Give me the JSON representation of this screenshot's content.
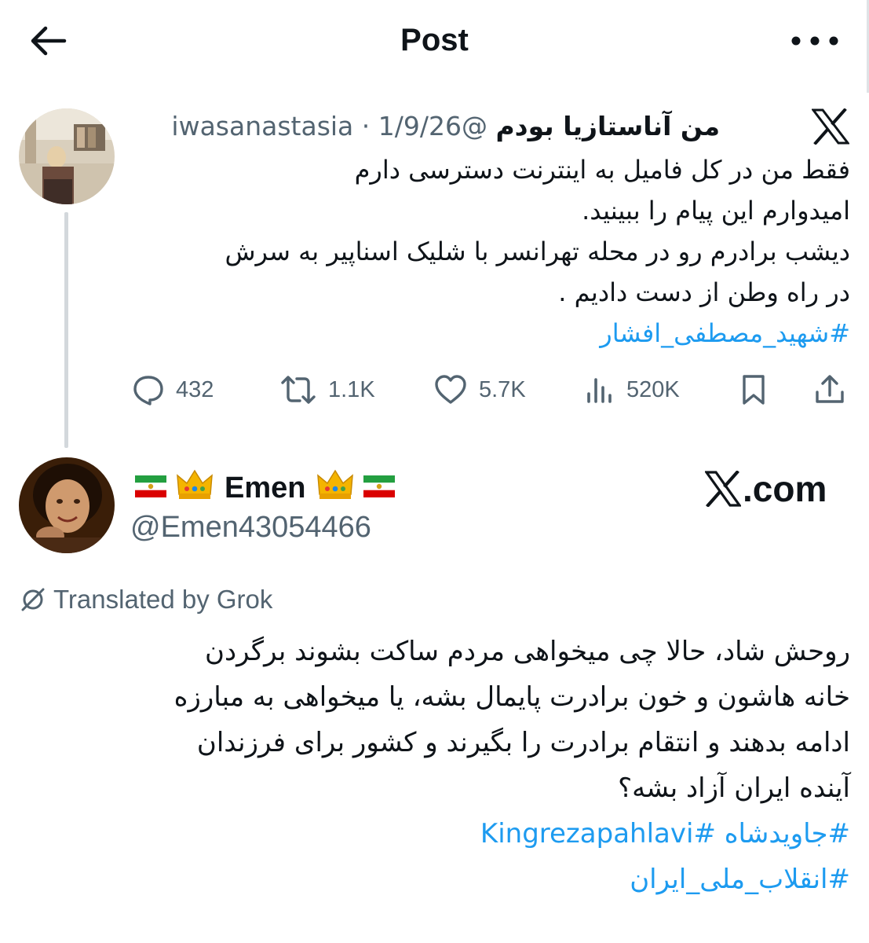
{
  "topbar": {
    "title": "Post"
  },
  "quoted_post": {
    "display_name": "من آناستازیا بودم",
    "handle": "@iwasanastasia",
    "separator": "·",
    "date": "1/9/26",
    "text_lines": [
      "فقط من در کل فامیل به اینترنت دسترسی دارم",
      "امیدوارم این پیام را ببینید.",
      "دیشب برادرم رو در محله تهرانسر با شلیک اسناپیر به سرش",
      "در راه وطن از دست دادیم ."
    ],
    "hashtag": "#شهید_مصطفی_افشار",
    "stats": {
      "replies": "432",
      "reposts": "1.1K",
      "likes": "5.7K",
      "views": "520K"
    }
  },
  "reply": {
    "display_name": "Emen",
    "handle": "@Emen43054466",
    "source_label": ".com",
    "translated_label": "Translated by Grok",
    "text_lines": [
      "روحش شاد، حالا چی میخواهی مردم ساکت بشوند برگردن",
      "خانه هاشون و خون برادرت پایمال بشه، یا میخواهی به مبارزه",
      "ادامه بدهند و انتقام برادرت را بگیرند و کشور برای فرزندان",
      "آینده ایران آزاد بشه؟"
    ],
    "hashtags_line1": "#جاویدشاه #Kingrezapahlavi",
    "hashtags_line2": "#انقلاب_ملی_ایران"
  },
  "colors": {
    "text": "#0f1419",
    "secondary": "#536471",
    "link": "#1d9bf0"
  },
  "icons": [
    "back-arrow-icon",
    "more-icon",
    "x-logo-icon",
    "reply-icon",
    "repost-icon",
    "like-icon",
    "views-icon",
    "bookmark-icon",
    "share-icon",
    "iran-flag-icon",
    "crown-icon",
    "translate-icon"
  ]
}
